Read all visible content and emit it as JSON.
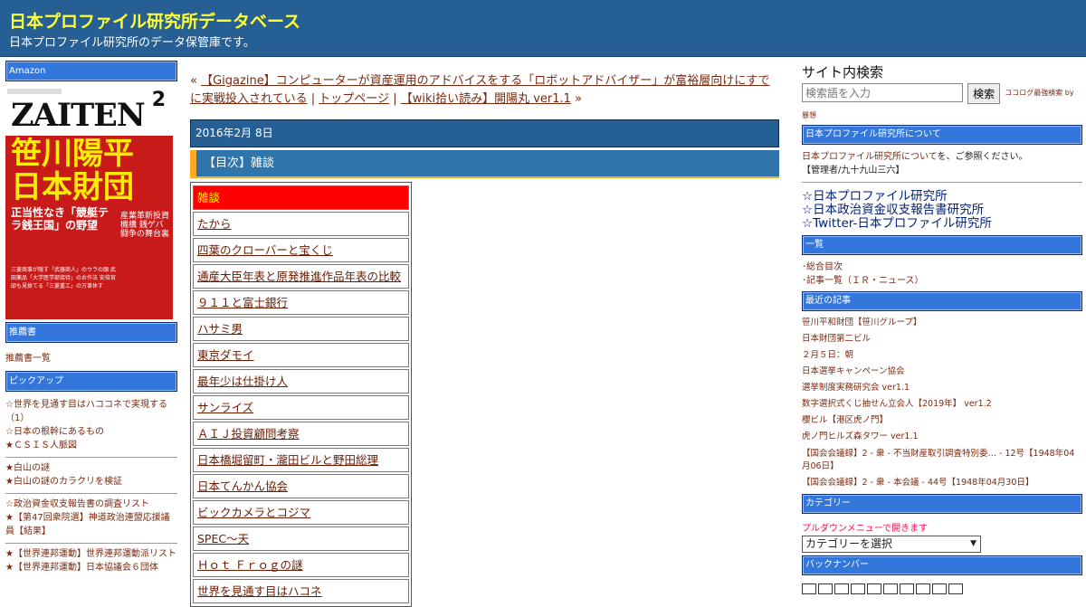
{
  "header": {
    "title": "日本プロファイル研究所データベース",
    "subtitle": "日本プロファイル研究所のデータ保管庫です。"
  },
  "left": {
    "amazon_heading": "Amazon",
    "book": {
      "magazine": "ZAITEN",
      "issue": "2",
      "headline_line1": "笹川陽平",
      "headline_line2": "日本財団",
      "subhead": "正当性なき「競艇テラ銭王国」の野望",
      "side_text": "産業革新投資機構 銭ゲバ闘争の舞台裏",
      "small_text": "三菱商事が隠す「武器商人」のウラの顔 武田薬品「大学医学部接待」のお作法 安倍官邸も見捨てる「三菱重工」の万事休す"
    },
    "recommend_heading": "推薦書",
    "recommend_link": "推薦書一覧",
    "pickup_heading": "ピックアップ",
    "pickup_group1": [
      "☆世界を見通す目はハココネで実現する（1）",
      "☆日本の根幹にあるもの",
      "★ＣＳＩＳ人脈図"
    ],
    "pickup_group2": [
      "★白山の謎",
      "★白山の謎のカラクリを検証"
    ],
    "pickup_group3": [
      "☆政治資金収支報告書の調査リスト",
      "★【第47回衆院選】神道政治連盟応援議員【結果】"
    ],
    "pickup_group4": [
      "★【世界連邦運動】世界連邦運動派リスト",
      "★【世界連邦運動】日本協議会６団体"
    ]
  },
  "center": {
    "prev_marker": "«",
    "prev_link": "【Gigazine】コンピューターが資産運用のアドバイスをする「ロボットアドバイザー」が富裕層向けにすでに実戦投入されている",
    "sep": "|",
    "top_link": "トップページ",
    "next_link": "【wiki拾い読み】開陽丸 ver1.1",
    "next_marker": "»",
    "date": "2016年2月 8日",
    "entry_title": "【目次】雑談",
    "toc": [
      "雑談",
      "たから",
      "四葉のクローバーと宝くじ",
      "通産大臣年表と原発推進作品年表の比較",
      "９１１と富士銀行",
      "ハサミ男",
      "東京ダモイ",
      "最年少は仕掛け人",
      "サンライズ",
      "ＡＩＪ投資顧問考察",
      "日本橋堀留町・瀧田ビルと野田総理",
      "日本てんかん協会",
      "ビックカメラとコジマ",
      "SPEC〜天",
      "Ｈｏｔ Ｆｒｏｇの謎",
      "世界を見通す目はハコネ"
    ]
  },
  "right": {
    "search_title": "サイト内検索",
    "search_placeholder": "検索語を入力",
    "search_button": "検索",
    "search_note1": "ココログ最強検索 by",
    "search_note2": "暴想",
    "about_heading": "日本プロファイル研究所について",
    "about_link": "日本プロファイル研究所について",
    "about_text": "を、ご参照ください。",
    "about_admin": "【管理者/九十九山三六】",
    "star_links": [
      "☆日本プロファイル研究所",
      "☆日本政治資金収支報告書研究所",
      "☆Twitter-日本プロファイル研究所"
    ],
    "list_heading": "一覧",
    "list_items": [
      "･総合目次",
      "･記事一覧（ＩＲ・ニュース）"
    ],
    "recent_heading": "最近の記事",
    "recent": [
      "笹川平和財団【笹川グループ】",
      "日本財団第二ビル",
      "２月５日：朝",
      "日本選挙キャンペーン協会",
      "選挙制度実務研究会 ver1.1",
      "数字選択式くじ抽せん立会人【2019年】 ver1.2",
      "櫻ビル【港区虎ノ門】",
      "虎ノ門ヒルズ森タワー ver1.1",
      "【国会会議録】2 - 衆 - 不当財産取引調査特別委… - 12号【1948年04月06日】",
      "【国会会議録】2 - 衆 - 本会議 - 44号【1948年04月30日】"
    ],
    "category_heading": "カテゴリー",
    "category_note": "プルダウンメニューで開きます",
    "category_select": "カテゴリーを選択",
    "backnumber_heading": "バックナンバー"
  },
  "colors": {
    "header": "#265f94",
    "title": "#ffff33",
    "side_heading": "#3377dd",
    "highlight": "#ff0000",
    "accent": "#ffaa22"
  }
}
